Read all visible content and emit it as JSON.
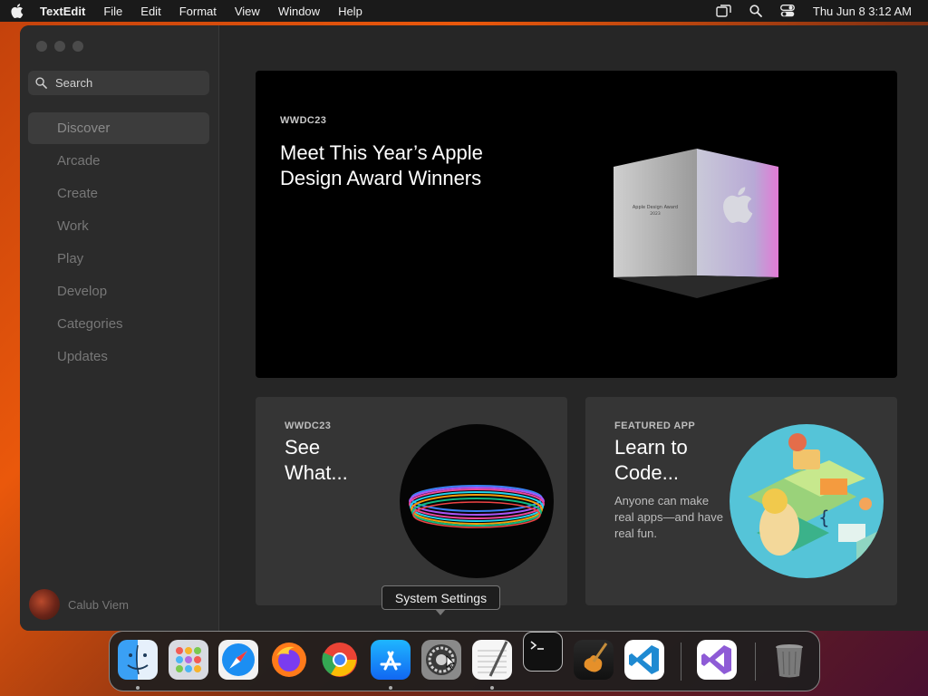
{
  "menubar": {
    "app_name": "TextEdit",
    "items": [
      "File",
      "Edit",
      "Format",
      "View",
      "Window",
      "Help"
    ],
    "clock": "Thu Jun 8  3:12 AM"
  },
  "sidebar": {
    "search_placeholder": "Search",
    "items": [
      {
        "label": "Discover"
      },
      {
        "label": "Arcade"
      },
      {
        "label": "Create"
      },
      {
        "label": "Work"
      },
      {
        "label": "Play"
      },
      {
        "label": "Develop"
      },
      {
        "label": "Categories"
      },
      {
        "label": "Updates"
      }
    ],
    "user_name": "Calub Viem"
  },
  "hero": {
    "eyebrow": "WWDC23",
    "title": "Meet This Year’s Apple Design Award Winners",
    "cube_text_line1": "Apple Design Award",
    "cube_text_line2": "2023"
  },
  "cards": [
    {
      "eyebrow": "WWDC23",
      "title": "See What..."
    },
    {
      "eyebrow": "FEATURED APP",
      "title": "Learn to Code...",
      "description": "Anyone can make real apps—and have real fun."
    }
  ],
  "tooltip": "System Settings",
  "dock": {
    "apps": [
      "finder-icon",
      "launchpad-icon",
      "safari-icon",
      "firefox-icon",
      "chrome-icon",
      "app-store-icon",
      "system-settings-icon",
      "textedit-icon",
      "terminal-icon",
      "garageband-icon",
      "vscode-icon",
      "visual-studio-icon",
      "trash-icon"
    ]
  }
}
